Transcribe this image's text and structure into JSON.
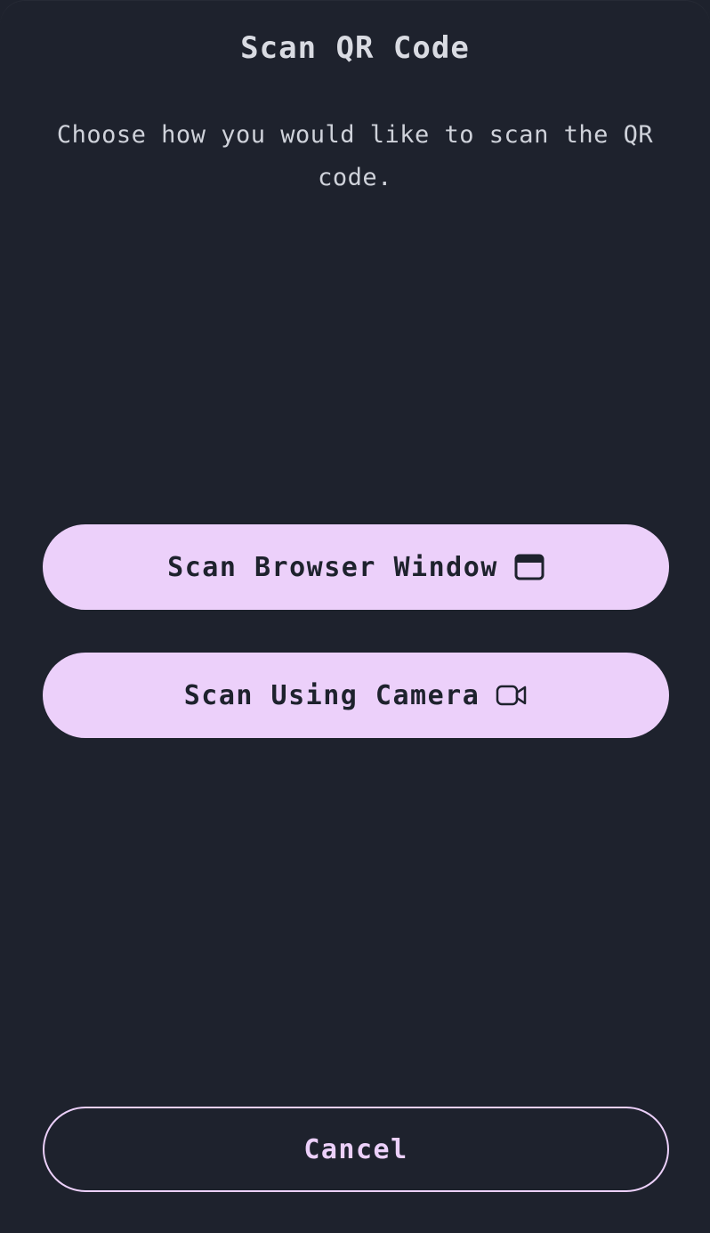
{
  "dialog": {
    "title": "Scan QR Code",
    "description": "Choose how you would like to scan the QR code."
  },
  "actions": {
    "browser_window": {
      "label": "Scan Browser Window",
      "icon": "browser-window-icon"
    },
    "camera": {
      "label": "Scan Using Camera",
      "icon": "video-camera-icon"
    },
    "cancel": {
      "label": "Cancel"
    }
  },
  "colors": {
    "background": "#1e222d",
    "accent": "#ecd0fa",
    "text": "#d9dbe2"
  }
}
